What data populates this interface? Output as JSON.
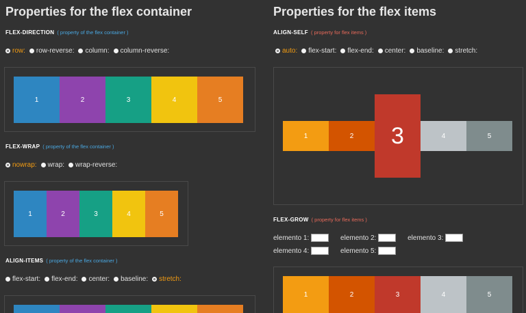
{
  "left": {
    "title": "Properties for the flex container",
    "flex_direction": {
      "label": "FLEX-DIRECTION",
      "note": "( property of the flex container )",
      "options": [
        "row:",
        "row-reverse:",
        "column:",
        "column-reverse:"
      ],
      "selected": "row:"
    },
    "flex_wrap": {
      "label": "FLEX-WRAP",
      "note": "( property of the flex container )",
      "options": [
        "nowrap:",
        "wrap:",
        "wrap-reverse:"
      ],
      "selected": "nowrap:"
    },
    "align_items": {
      "label": "ALIGN-ITEMS",
      "note": "( property of the flex container )",
      "options": [
        "flex-start:",
        "flex-end:",
        "center:",
        "baseline:",
        "stretch:"
      ],
      "selected": "stretch:"
    },
    "items": [
      "1",
      "2",
      "3",
      "4",
      "5"
    ]
  },
  "right": {
    "title": "Properties for the flex items",
    "align_self": {
      "label": "ALIGN-SELF",
      "note": "( property for flex items )",
      "options": [
        "auto:",
        "flex-start:",
        "flex-end:",
        "center:",
        "baseline:",
        "stretch:"
      ],
      "selected": "auto:"
    },
    "flex_grow": {
      "label": "FLEX-GROW",
      "note": "( property for flex items )",
      "fields": [
        {
          "label": "elemento 1:",
          "value": ""
        },
        {
          "label": "elemento 2:",
          "value": ""
        },
        {
          "label": "elemento 3:",
          "value": ""
        },
        {
          "label": "elemento 4:",
          "value": ""
        },
        {
          "label": "elemento 5:",
          "value": ""
        }
      ]
    },
    "items": [
      "1",
      "2",
      "3",
      "4",
      "5"
    ]
  },
  "colors": {
    "background": "#323232",
    "blue": "#2e86c1",
    "purple": "#8e44ad",
    "teal": "#16a085",
    "yellow": "#f1c40f",
    "orange": "#e67e22",
    "light_orange": "#f39c12",
    "dark_orange": "#d35400",
    "red": "#c0392b",
    "silver": "#bdc3c7",
    "gray": "#7f8c8d",
    "selected_label": "#f39c12",
    "note_blue": "#4aa7e0",
    "note_red": "#e86a5a"
  }
}
